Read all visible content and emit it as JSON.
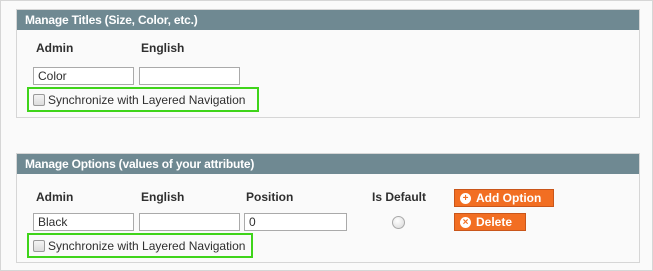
{
  "titles_section": {
    "header": "Manage Titles (Size, Color, etc.)",
    "columns": {
      "admin": "Admin",
      "english": "English"
    },
    "admin_value": "Color",
    "english_value": "",
    "sync_label": "Synchronize with Layered Navigation",
    "sync_checked": false
  },
  "options_section": {
    "header": "Manage Options (values of your attribute)",
    "columns": {
      "admin": "Admin",
      "english": "English",
      "position": "Position",
      "is_default": "Is Default"
    },
    "add_option_label": "Add Option",
    "delete_label": "Delete",
    "row": {
      "admin": "Black",
      "english": "",
      "position": "0",
      "is_default": false
    },
    "sync_label": "Synchronize with Layered Navigation",
    "sync_checked": false
  },
  "icons": {
    "add": "plus-circle-icon",
    "delete": "x-circle-icon"
  },
  "colors": {
    "header_bg": "#6f8992",
    "button_bg": "#f26e22",
    "highlight": "#3fd41a"
  }
}
